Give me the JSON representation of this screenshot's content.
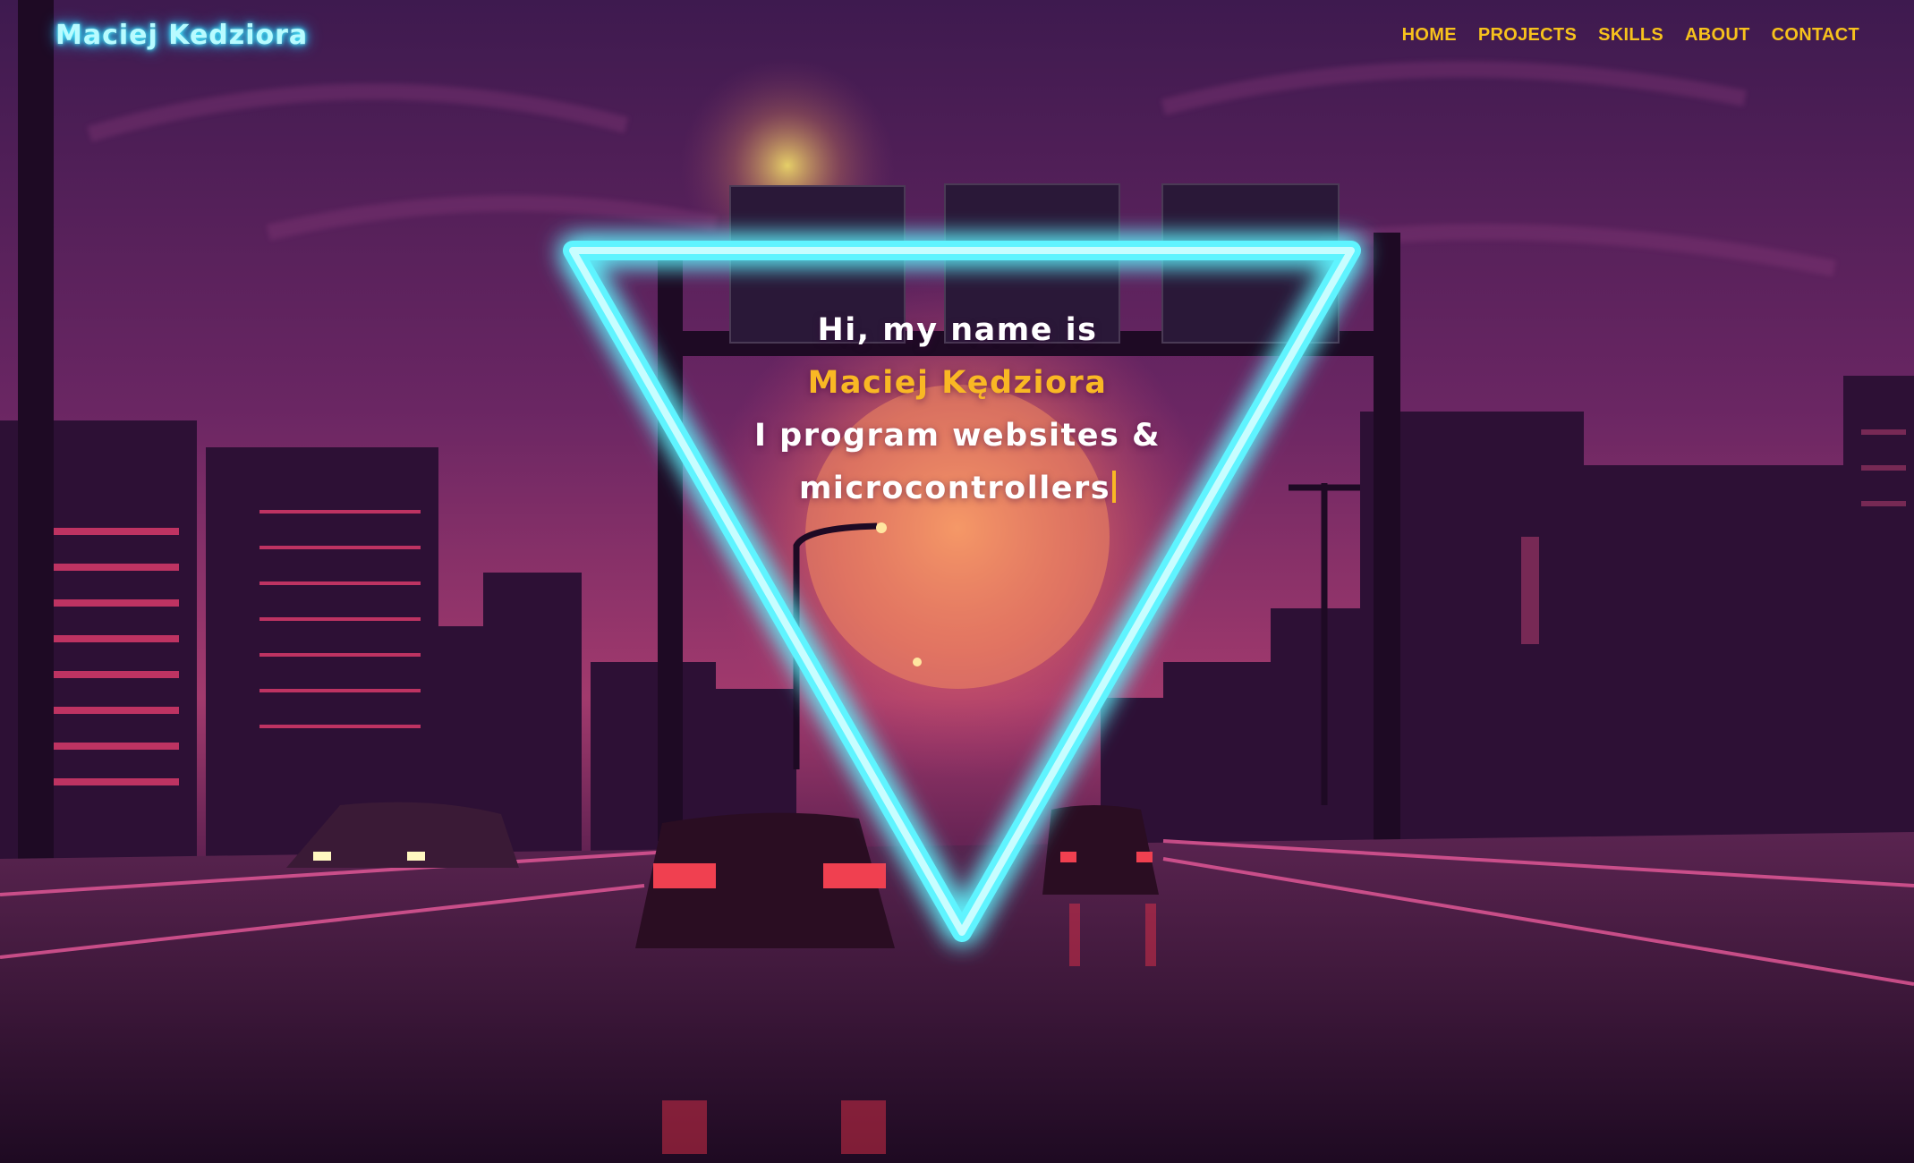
{
  "header": {
    "logo": "Maciej Kedziora",
    "nav": [
      {
        "label": "HOME"
      },
      {
        "label": "PROJECTS"
      },
      {
        "label": "SKILLS"
      },
      {
        "label": "ABOUT"
      },
      {
        "label": "CONTACT"
      }
    ]
  },
  "hero": {
    "greeting": "Hi, my name is",
    "name": "Maciej Kędziora",
    "tagline_1": "I program websites &",
    "tagline_2": "microcontrollers"
  },
  "colors": {
    "accent": "#f7c21c",
    "neon": "#4ff3ff",
    "sky_top": "#3b1a4c",
    "sky_mid": "#7a2a6a",
    "sun": "#f88a5a"
  },
  "icons": {
    "hero_graphic": "neon-triangle-icon",
    "background": "synthwave-highway-city"
  }
}
